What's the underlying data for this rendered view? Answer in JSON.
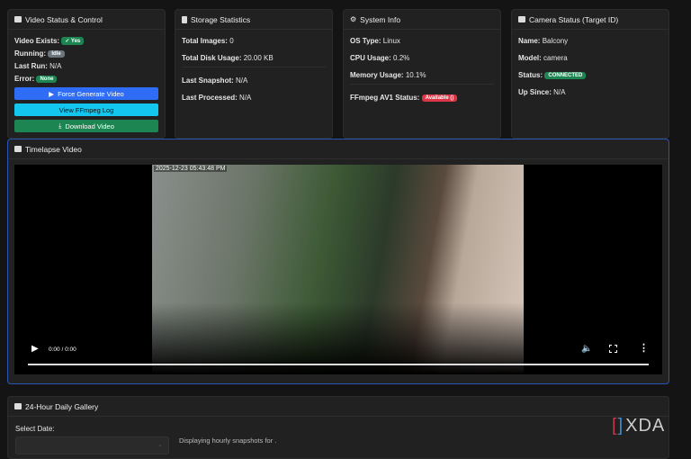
{
  "video_status": {
    "title": "Video Status & Control",
    "video_exists_label": "Video Exists:",
    "video_exists": "✓ Yes",
    "running_label": "Running:",
    "running": "Idle",
    "last_run_label": "Last Run:",
    "last_run": "N/A",
    "error_label": "Error:",
    "error": "None",
    "force_generate": "Force Generate Video",
    "view_log": "View FFmpeg Log",
    "download": "Download Video"
  },
  "storage": {
    "title": "Storage Statistics",
    "total_images_label": "Total Images:",
    "total_images": "0",
    "disk_label": "Total Disk Usage:",
    "disk": "20.00 KB",
    "last_snapshot_label": "Last Snapshot:",
    "last_snapshot": "N/A",
    "last_processed_label": "Last Processed:",
    "last_processed": "N/A"
  },
  "system": {
    "title": "System Info",
    "os_label": "OS Type:",
    "os": "Linux",
    "cpu_label": "CPU Usage:",
    "cpu": "0.2%",
    "mem_label": "Memory Usage:",
    "mem": "10.1%",
    "ffmpeg_label": "FFmpeg AV1 Status:",
    "ffmpeg": "Available ()"
  },
  "camera": {
    "title": "Camera Status (Target ID)",
    "name_label": "Name:",
    "name": "Balcony",
    "model_label": "Model:",
    "model": "camera",
    "status_label": "Status:",
    "status": "CONNECTED",
    "up_label": "Up Since:",
    "up": "N/A"
  },
  "timelapse": {
    "title": "Timelapse Video",
    "timestamp": "2025-12-23 05:43:48 PM",
    "time": "0:00 / 0:00"
  },
  "gallery": {
    "title": "24-Hour Daily Gallery",
    "select_label": "Select Date:",
    "date_value": "",
    "displaying": "Displaying hourly snapshots for ."
  },
  "watermark": "XDA",
  "colors": {
    "primary": "#2f6df6",
    "info": "#12c6ee",
    "success": "#1d8552",
    "danger": "#dc3545",
    "secondary": "#6c757d"
  }
}
